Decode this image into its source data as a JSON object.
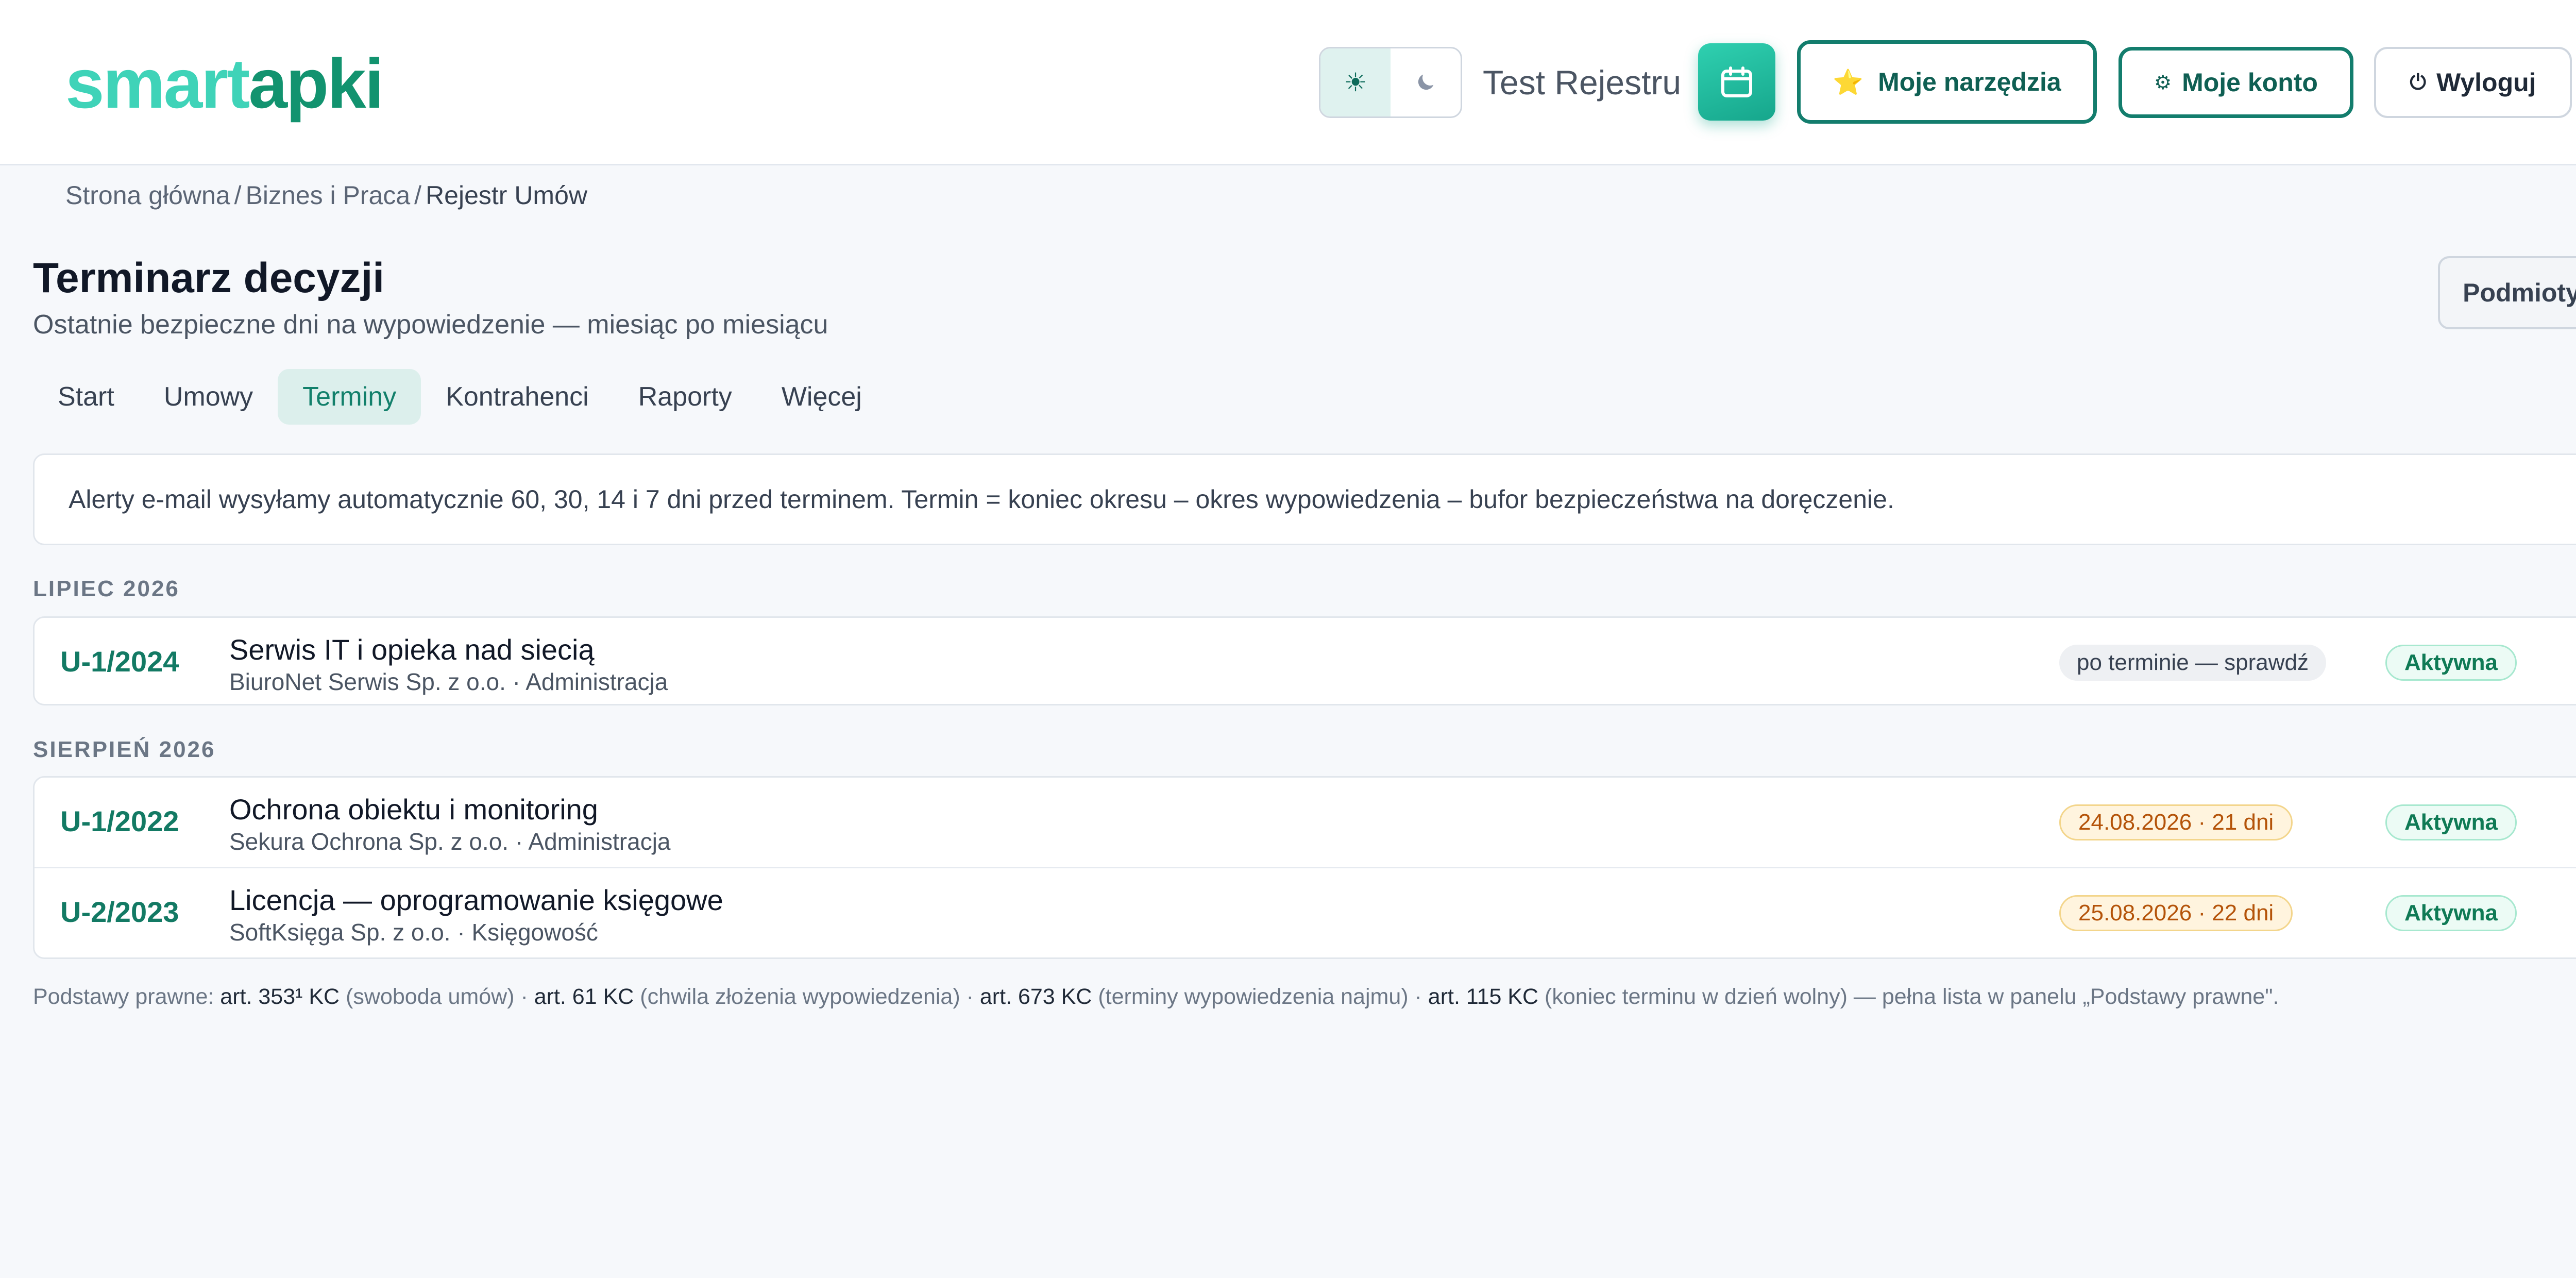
{
  "header": {
    "logo_part1": "smart",
    "logo_part2": "apki",
    "theme_light_icon": "sun-icon",
    "theme_dark_icon": "moon-icon",
    "user_name": "Test Rejestru",
    "calendar_icon": "calendar-icon",
    "tools_label": "Moje narzędzia",
    "tools_icon": "⭐",
    "account_label": "Moje konto",
    "account_icon": "⚙",
    "logout_label": "Wyloguj",
    "logout_icon": "⏻"
  },
  "breadcrumb": {
    "items": [
      "Strona główna",
      "Biznes i Praca",
      "Rejestr Umów"
    ],
    "separator": "/"
  },
  "page": {
    "title": "Terminarz decyzji",
    "subtitle": "Ostatnie bezpieczne dni na wypowiedzenie — miesiąc po miesiącu",
    "entities_button": "Podmioty"
  },
  "tabs": [
    {
      "label": "Start",
      "active": false
    },
    {
      "label": "Umowy",
      "active": false
    },
    {
      "label": "Terminy",
      "active": true
    },
    {
      "label": "Kontrahenci",
      "active": false
    },
    {
      "label": "Raporty",
      "active": false
    },
    {
      "label": "Więcej",
      "active": false
    }
  ],
  "alert": "Alerty e-mail wysyłamy automatycznie 60, 30, 14 i 7 dni przed terminem. Termin = koniec okresu – okres wypowiedzenia – bufor bezpieczeństwa na doręczenie.",
  "groups": [
    {
      "month": "LIPIEC 2026",
      "rows": [
        {
          "ref": "U-1/2024",
          "title": "Serwis IT i opieka nad siecią",
          "meta": "BiuroNet Serwis Sp. z o.o. · Administracja",
          "deadline": "po terminie — sprawdź",
          "deadline_style": "gray",
          "status": "Aktywna"
        }
      ]
    },
    {
      "month": "SIERPIEŃ 2026",
      "rows": [
        {
          "ref": "U-1/2022",
          "title": "Ochrona obiektu i monitoring",
          "meta": "Sekura Ochrona Sp. z o.o. · Administracja",
          "deadline": "24.08.2026 · 21 dni",
          "deadline_style": "amber",
          "status": "Aktywna"
        },
        {
          "ref": "U-2/2023",
          "title": "Licencja — oprogramowanie księgowe",
          "meta": "SoftKsięga Sp. z o.o. · Księgowość",
          "deadline": "25.08.2026 · 22 dni",
          "deadline_style": "amber",
          "status": "Aktywna"
        }
      ]
    }
  ],
  "footer": {
    "prefix": "Podstawy prawne: ",
    "items": [
      {
        "code": "art. 353¹ KC",
        "desc": " (swoboda umów)"
      },
      {
        "code": "art. 61 KC",
        "desc": " (chwila złożenia wypowiedzenia)"
      },
      {
        "code": "art. 673 KC",
        "desc": " (terminy wypowiedzenia najmu)"
      },
      {
        "code": "art. 115 KC",
        "desc": " (koniec terminu w dzień wolny)"
      }
    ],
    "separator": " · ",
    "suffix": " — pełna lista w panelu „Podstawy prawne\"."
  },
  "colors": {
    "brand_light": "#3fd3b8",
    "brand_dark": "#12936f",
    "accent": "#137d6d",
    "status_green": "#0f7a55",
    "deadline_amber": "#b45309"
  }
}
